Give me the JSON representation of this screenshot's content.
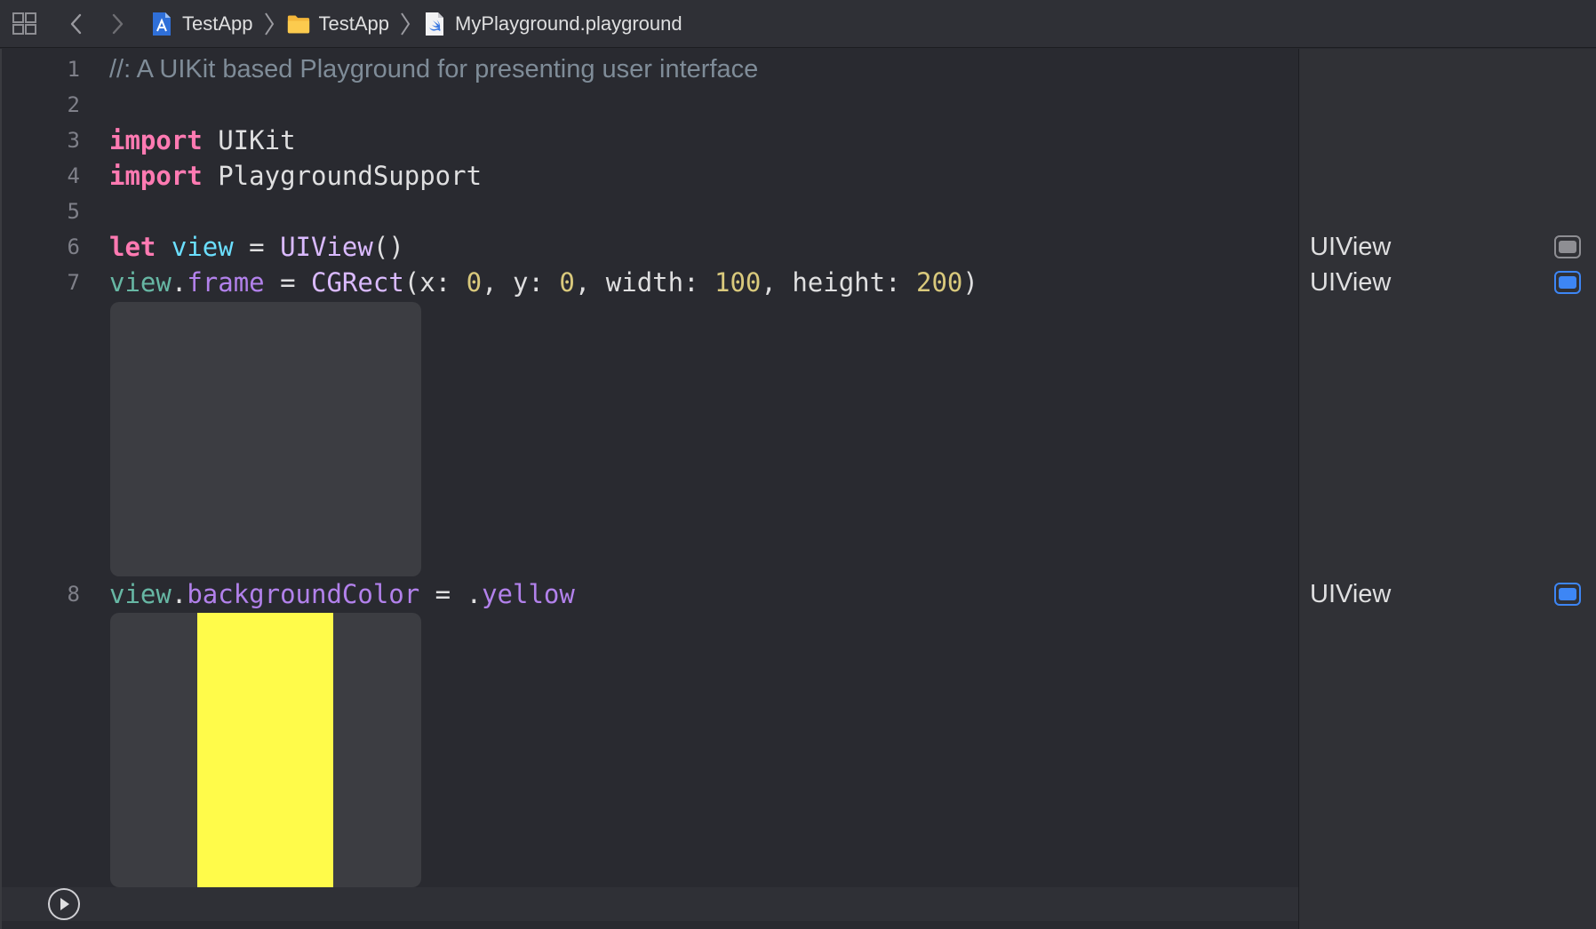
{
  "jumpbar": {
    "breadcrumbs": [
      {
        "label": "TestApp",
        "icon": "xcode-project-icon"
      },
      {
        "label": "TestApp",
        "icon": "folder-icon"
      },
      {
        "label": "MyPlayground.playground",
        "icon": "swift-file-icon"
      }
    ]
  },
  "editor": {
    "lines": [
      {
        "number": "1",
        "comment": "//: A UIKit based Playground for presenting user interface"
      },
      {
        "number": "2"
      },
      {
        "number": "3",
        "kw": "import",
        "rest": " UIKit"
      },
      {
        "number": "4",
        "kw": "import",
        "rest": " PlaygroundSupport"
      },
      {
        "number": "5"
      },
      {
        "number": "6",
        "kw": "let",
        "decl": "view",
        "eq": " = ",
        "type": "UIView",
        "tail": "()"
      },
      {
        "number": "7",
        "var": "view",
        "dot": ".",
        "prop": "frame",
        "eq": " = ",
        "type": "CGRect",
        "args": [
          "(x: ",
          "0",
          ", y: ",
          "0",
          ", width: ",
          "100",
          ", height: ",
          "200",
          ")"
        ]
      },
      {
        "number": "8",
        "var": "view",
        "dot": ".",
        "prop": "backgroundColor",
        "eq": " = ",
        "dot2": ".",
        "prop2": "yellow"
      }
    ],
    "preview_fill": "#fffb4a"
  },
  "results": [
    {
      "label": "UIView",
      "line": "6",
      "style": "gray"
    },
    {
      "label": "UIView",
      "line": "7",
      "style": "blue"
    },
    {
      "label": "UIView",
      "line": "8",
      "style": "blue"
    }
  ],
  "colors": {
    "keyword": "#ff7ab2",
    "type": "#dabaff",
    "number": "#d9c97c",
    "property": "#b281eb",
    "comment": "#7f8c98",
    "accent": "#3d86f5"
  }
}
